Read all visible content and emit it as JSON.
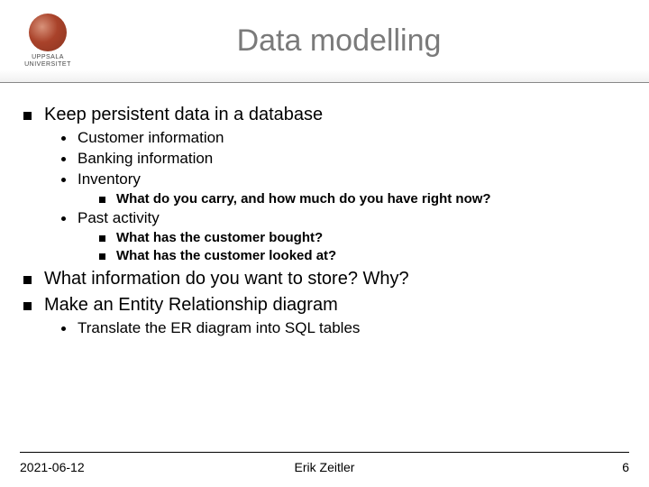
{
  "logo": {
    "line1": "UPPSALA",
    "line2": "UNIVERSITET"
  },
  "title": "Data modelling",
  "bullets": {
    "b1": "Keep persistent data in a database",
    "b1a": "Customer information",
    "b1b": "Banking information",
    "b1c": "Inventory",
    "b1c1": "What do you carry, and how much do you have right now?",
    "b1d": "Past activity",
    "b1d1": "What has the customer bought?",
    "b1d2": "What has the customer looked at?",
    "b2": "What information do you want to store? Why?",
    "b3": "Make an Entity Relationship diagram",
    "b3a": "Translate the ER diagram into SQL tables"
  },
  "footer": {
    "date": "2021-06-12",
    "author": "Erik Zeitler",
    "page": "6"
  }
}
